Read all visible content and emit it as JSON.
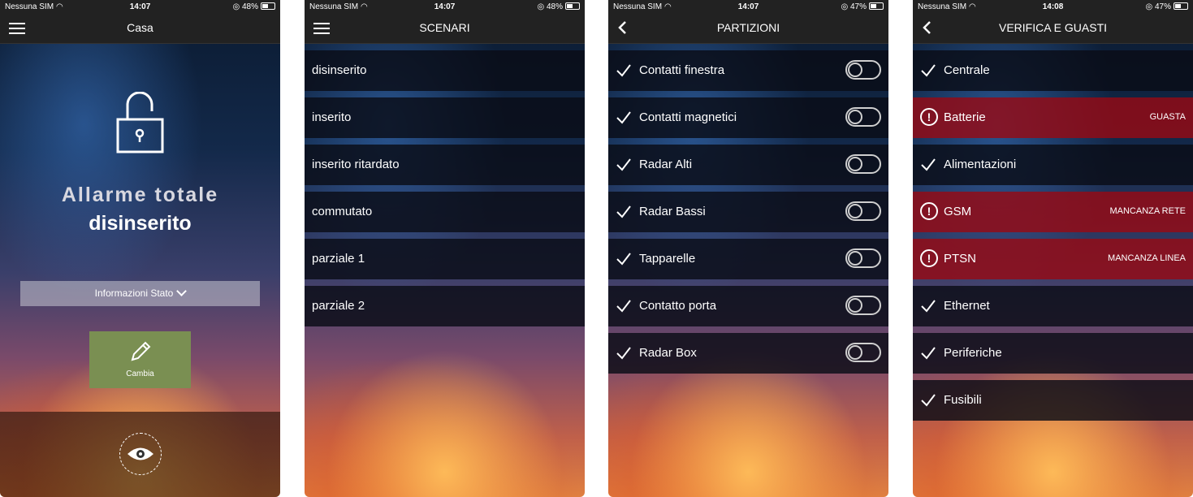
{
  "status": [
    {
      "carrier": "Nessuna SIM",
      "time": "14:07",
      "battery": "48%",
      "battery_level": 0.48
    },
    {
      "carrier": "Nessuna SIM",
      "time": "14:07",
      "battery": "48%",
      "battery_level": 0.48
    },
    {
      "carrier": "Nessuna SIM",
      "time": "14:07",
      "battery": "47%",
      "battery_level": 0.47
    },
    {
      "carrier": "Nessuna SIM",
      "time": "14:08",
      "battery": "47%",
      "battery_level": 0.47
    }
  ],
  "home": {
    "title": "Casa",
    "alarm_title": "Allarme totale",
    "alarm_state": "disinserito",
    "info_button": "Informazioni Stato",
    "change_button": "Cambia"
  },
  "scenari": {
    "title": "SCENARI",
    "items": [
      "disinserito",
      "inserito",
      "inserito ritardato",
      "commutato",
      "parziale 1",
      "parziale 2"
    ]
  },
  "partizioni": {
    "title": "PARTIZIONI",
    "items": [
      {
        "label": "Contatti finestra",
        "on": false
      },
      {
        "label": "Contatti magnetici",
        "on": false
      },
      {
        "label": "Radar Alti",
        "on": false
      },
      {
        "label": "Radar Bassi",
        "on": false
      },
      {
        "label": "Tapparelle",
        "on": false
      },
      {
        "label": "Contatto porta",
        "on": false
      },
      {
        "label": "Radar Box",
        "on": false
      }
    ]
  },
  "verifica": {
    "title": "VERIFICA E GUASTI",
    "items": [
      {
        "label": "Centrale",
        "status": "ok",
        "detail": ""
      },
      {
        "label": "Batterie",
        "status": "fault",
        "detail": "GUASTA"
      },
      {
        "label": "Alimentazioni",
        "status": "ok",
        "detail": ""
      },
      {
        "label": "GSM",
        "status": "fault",
        "detail": "MANCANZA RETE"
      },
      {
        "label": "PTSN",
        "status": "fault",
        "detail": "MANCANZA LINEA"
      },
      {
        "label": "Ethernet",
        "status": "ok",
        "detail": ""
      },
      {
        "label": "Periferiche",
        "status": "ok",
        "detail": ""
      },
      {
        "label": "Fusibili",
        "status": "ok",
        "detail": ""
      }
    ]
  }
}
